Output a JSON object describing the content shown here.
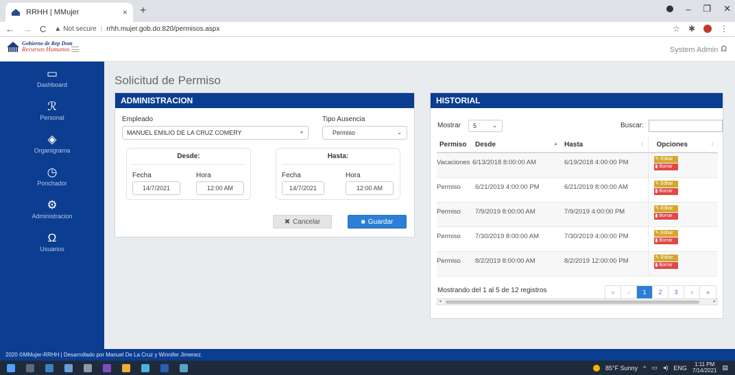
{
  "browser": {
    "tab_title": "RRHH | MMujer",
    "tab_close": "×",
    "new_tab": "+",
    "security_label": "Not secure",
    "url": "rrhh.mujer.gob.do:820/permisos.aspx",
    "win_minimize": "–",
    "win_restore": "❐",
    "win_close": "✕"
  },
  "header": {
    "logo_line1": "Gobierno de Rep Dom",
    "logo_line2": "Recursos Humanos",
    "user_name": "System Admin"
  },
  "sidebar": {
    "items": [
      {
        "label": "Dashboard",
        "icon": "monitor-icon"
      },
      {
        "label": "Personal",
        "icon": "person-icon"
      },
      {
        "label": "Organigrama",
        "icon": "layers-icon"
      },
      {
        "label": "Ponchador",
        "icon": "clock-icon"
      },
      {
        "label": "Administracion",
        "icon": "gear-icon"
      },
      {
        "label": "Usuarios",
        "icon": "user-icon"
      }
    ]
  },
  "page": {
    "title": "Solicitud de Permiso"
  },
  "admin": {
    "header": "ADMINISTRACION",
    "empleado_label": "Empleado",
    "empleado_value": "MANUEL EMILIO DE LA CRUZ COMERY",
    "tipo_label": "Tipo Ausencia",
    "tipo_value": "Permiso",
    "desde_title": "Desde:",
    "hasta_title": "Hasta:",
    "fecha_label": "Fecha",
    "hora_label": "Hora",
    "desde_fecha": "14/7/2021",
    "desde_hora": "12:00 AM",
    "hasta_fecha": "14/7/2021",
    "hasta_hora": "12:00 AM",
    "cancel_label": "Cancelar",
    "save_label": "Guardar"
  },
  "historial": {
    "header": "HISTORIAL",
    "mostrar_label": "Mostrar",
    "page_size": "5",
    "buscar_label": "Buscar:",
    "columns": [
      "Permiso",
      "Desde",
      "Hasta",
      "Opciones"
    ],
    "edit_label": "Editar",
    "delete_label": "Borrar",
    "rows": [
      {
        "permiso": "Vacaciones",
        "desde": "6/13/2018 8:00:00 AM",
        "hasta": "6/19/2018 4:00:00 PM"
      },
      {
        "permiso": "Permiso",
        "desde": "6/21/2019 4:00:00 PM",
        "hasta": "6/21/2019 8:00:00 AM"
      },
      {
        "permiso": "Permiso",
        "desde": "7/9/2019 8:00:00 AM",
        "hasta": "7/9/2019 4:00:00 PM"
      },
      {
        "permiso": "Permiso",
        "desde": "7/30/2019 8:00:00 AM",
        "hasta": "7/30/2019 4:00:00 PM"
      },
      {
        "permiso": "Permiso",
        "desde": "8/2/2019 8:00:00 AM",
        "hasta": "8/2/2019 12:00:00 PM"
      }
    ],
    "info": "Mostrando del 1 al 5 de 12 registros",
    "pager": {
      "first": "«",
      "prev": "‹",
      "pages": [
        "1",
        "2",
        "3"
      ],
      "next": "›",
      "last": "»",
      "current": "1"
    }
  },
  "footer": {
    "text": "2020 ©MMujer-RRHH | Desarrollado por Manuel De La Cruz y Winnifer Jimenez."
  },
  "taskbar": {
    "weather": "85°F Sunny",
    "lang": "ENG",
    "time": "1:11 PM",
    "date": "7/14/2021"
  },
  "colors": {
    "brand_blue": "#0b3d91",
    "primary": "#2b7fd6",
    "edit": "#d4a72c",
    "delete": "#e04848"
  }
}
